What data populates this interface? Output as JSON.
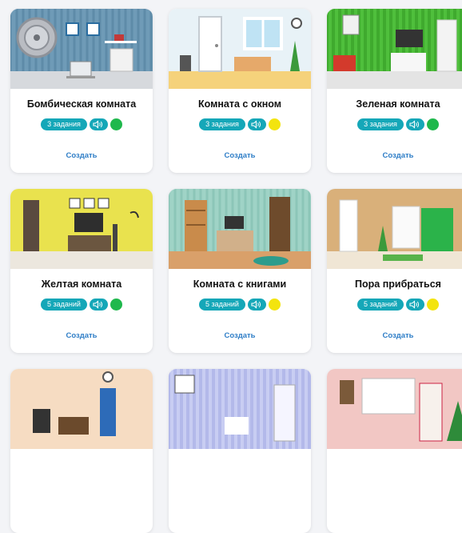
{
  "rooms": [
    {
      "title": "Бомбическая комната",
      "tasks": "3 задания",
      "difficulty_color": "#1fb84c",
      "create_label": "Создать",
      "scene": "bomb"
    },
    {
      "title": "Комната с окном",
      "tasks": "3 задания",
      "difficulty_color": "#f3e40e",
      "create_label": "Создать",
      "scene": "window"
    },
    {
      "title": "Зеленая комната",
      "tasks": "3 задания",
      "difficulty_color": "#1fb84c",
      "create_label": "Создать",
      "scene": "green"
    },
    {
      "title": "Желтая комната",
      "tasks": "5 заданий",
      "difficulty_color": "#1fb84c",
      "create_label": "Создать",
      "scene": "yellow"
    },
    {
      "title": "Комната с книгами",
      "tasks": "5 заданий",
      "difficulty_color": "#f3e40e",
      "create_label": "Создать",
      "scene": "books"
    },
    {
      "title": "Пора прибраться",
      "tasks": "5 заданий",
      "difficulty_color": "#f3e40e",
      "create_label": "Создать",
      "scene": "cleanup"
    },
    {
      "title": "",
      "tasks": "",
      "difficulty_color": "",
      "create_label": "",
      "scene": "orange"
    },
    {
      "title": "",
      "tasks": "",
      "difficulty_color": "",
      "create_label": "",
      "scene": "winter"
    },
    {
      "title": "",
      "tasks": "",
      "difficulty_color": "",
      "create_label": "",
      "scene": "xmas"
    }
  ],
  "icons": {
    "sound": "speaker-icon"
  },
  "colors": {
    "accent": "#15a7b8",
    "link": "#2f7ec7"
  }
}
